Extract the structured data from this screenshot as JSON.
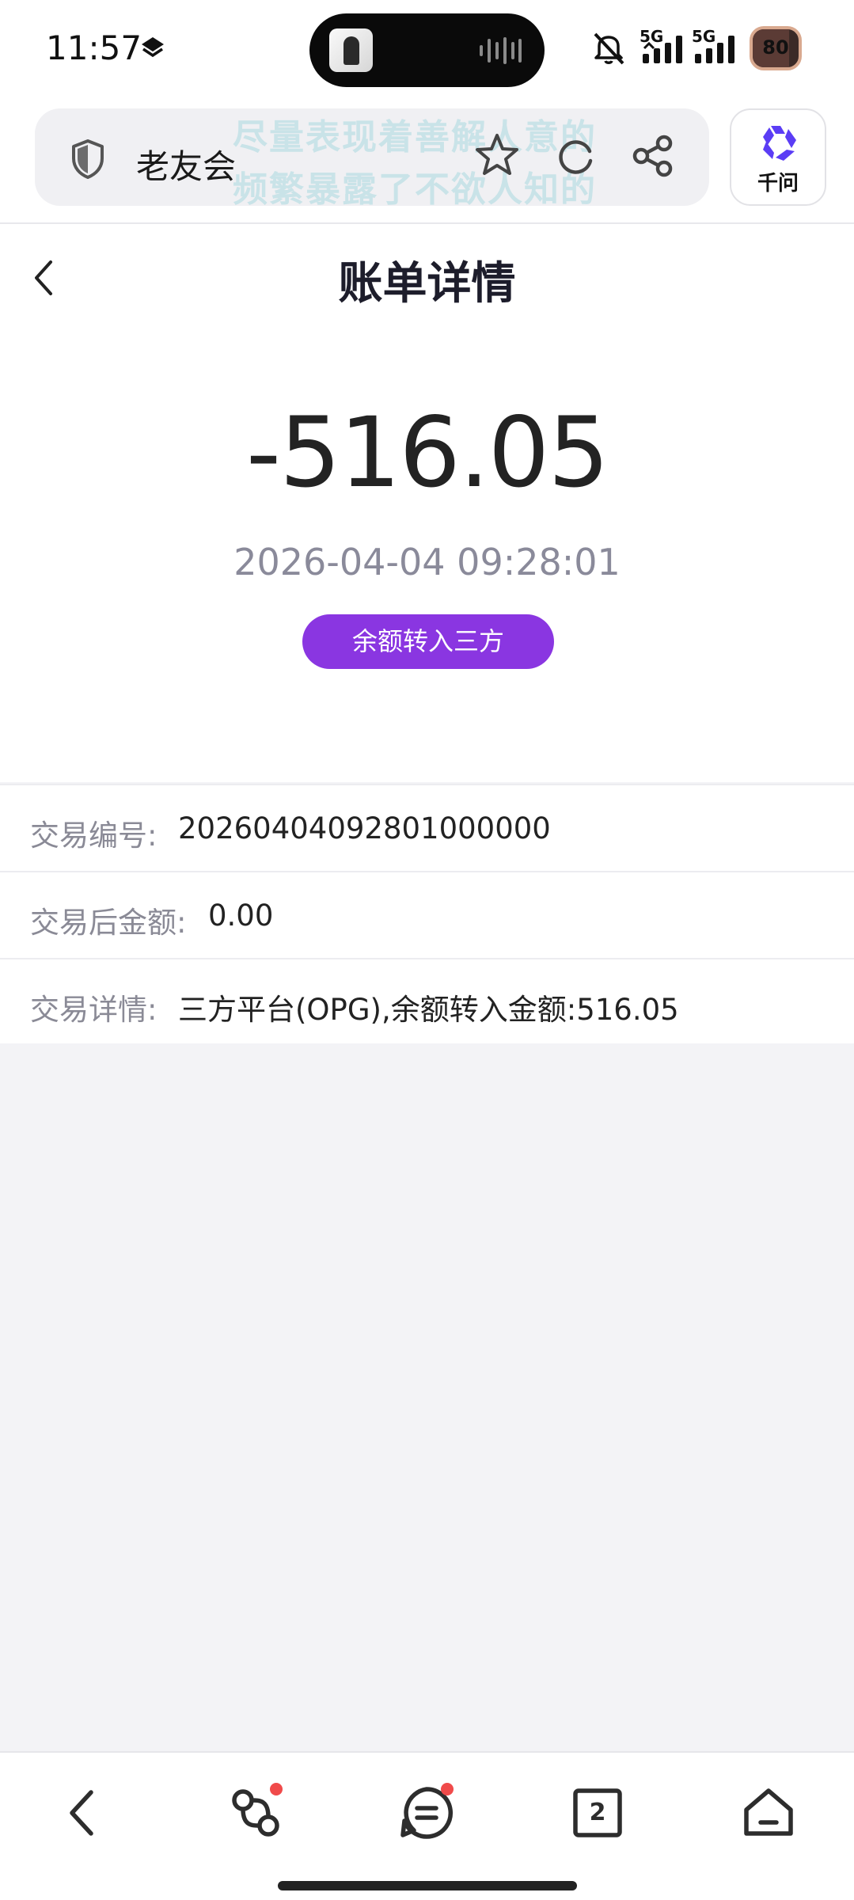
{
  "status_bar": {
    "time": "11:57",
    "signal_1_label": "5G",
    "signal_2_label": "5G",
    "battery": "80",
    "battery_level": 0.8
  },
  "browser": {
    "site_name": "老友会",
    "watermark_line1": "尽量表现着善解人意的",
    "watermark_line2": "频繁暴露了不欲人知的",
    "assistant_label": "千问"
  },
  "header": {
    "title": "账单详情"
  },
  "summary": {
    "amount": "-516.05",
    "datetime": "2026-04-04 09:28:01",
    "type_tag": "余额转入三方"
  },
  "details": [
    {
      "label": "交易编号:",
      "value": "20260404092801000000"
    },
    {
      "label": "交易后金额:",
      "value": "0.00"
    },
    {
      "label": "交易详情:",
      "value": "三方平台(OPG),余额转入金额:516.05"
    }
  ],
  "bottom_nav": {
    "tab_count": "2"
  },
  "colors": {
    "accent": "#8a36e1",
    "assistant": "#5b3df5",
    "badge": "#f04a4a"
  }
}
